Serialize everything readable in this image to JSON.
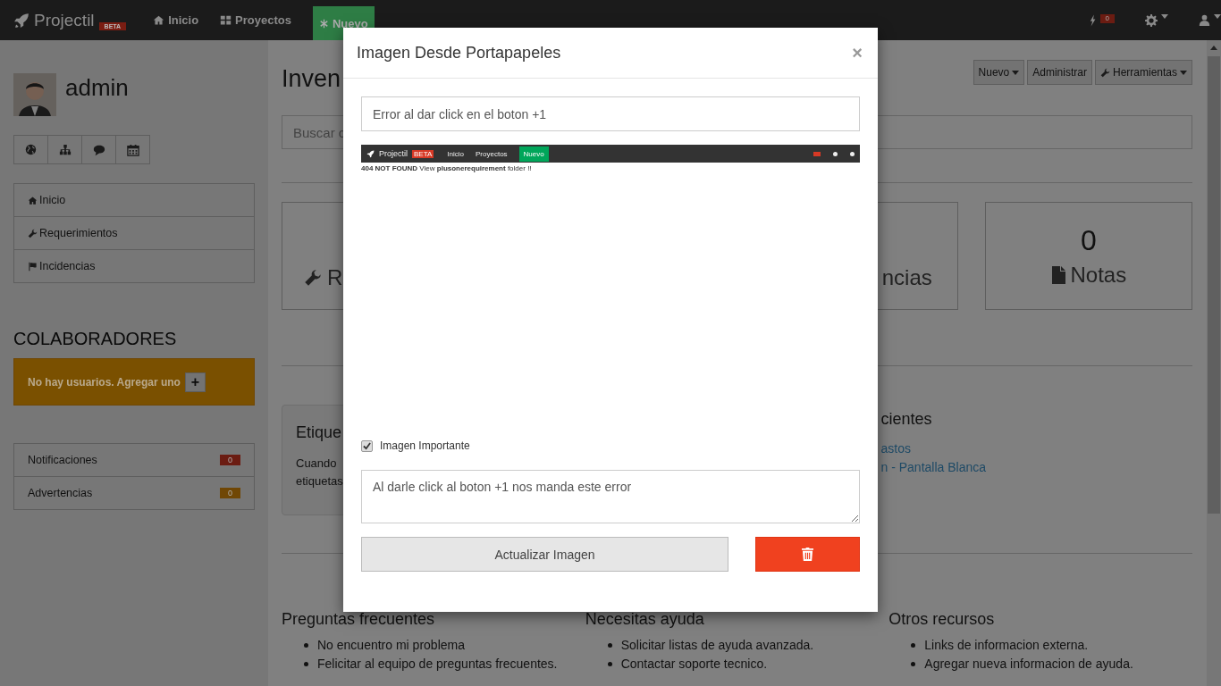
{
  "navbar": {
    "brand": "Projectil",
    "badge": "BETA",
    "links": [
      {
        "label": "Inicio"
      },
      {
        "label": "Proyectos"
      }
    ],
    "new_button": {
      "label": "Nuevo"
    },
    "alerts_count": "0"
  },
  "sidebar": {
    "user": {
      "name": "admin"
    },
    "menu": [
      {
        "label": "Inicio"
      },
      {
        "label": "Requerimientos"
      },
      {
        "label": "Incidencias"
      }
    ],
    "collaborators": {
      "title": "COLABORADORES",
      "message": "No hay usuarios. Agregar uno",
      "add": "+"
    },
    "counters": [
      {
        "label": "Notificaciones",
        "count": "0",
        "color": "#6b1c12"
      },
      {
        "label": "Advertencias",
        "count": "0",
        "color": "#704705"
      }
    ]
  },
  "main": {
    "title": "Inven",
    "toolbar": [
      {
        "label": "Nuevo",
        "caret": true
      },
      {
        "label": "Administrar",
        "caret": false
      },
      {
        "label": "Herramientas",
        "caret": true
      }
    ],
    "search": {
      "placeholder": "Buscar c"
    },
    "stats": [
      {
        "label": "R"
      },
      {
        "label": "ncias"
      },
      {
        "number": "0",
        "label": "Notas"
      }
    ],
    "tags_panel": {
      "title": "Etique",
      "lines": [
        "Cuando",
        "etiquetas"
      ]
    },
    "recent": {
      "title": "cientes",
      "links": [
        "astos",
        "n - Pantalla Blanca"
      ]
    },
    "footer": [
      {
        "title": "Preguntas frecuentes",
        "items": [
          "No encuentro mi problema",
          "Felicitar al equipo de preguntas frecuentes."
        ]
      },
      {
        "title": "Necesitas ayuda",
        "items": [
          "Solicitar listas de ayuda avanzada.",
          "Contactar soporte tecnico."
        ]
      },
      {
        "title": "Otros recursos",
        "items": [
          "Links de informacion externa.",
          "Agregar nueva informacion de ayuda."
        ]
      }
    ]
  },
  "modal": {
    "title": "Imagen Desde Portapapeles",
    "close": "×",
    "subject": "Error al dar click en el boton +1",
    "screenshot": {
      "brand": "Projectil",
      "badge": "BETA",
      "links": [
        "Inicio",
        "Proyectos"
      ],
      "new_button": "Nuevo",
      "message": "**404 NOT FOUND** View **plusonerequirement** folder !!"
    },
    "important": {
      "label": "Imagen Importante",
      "checked": true
    },
    "description": "Al darle click al boton +1 nos manda este error",
    "update_button": "Actualizar Imagen"
  }
}
